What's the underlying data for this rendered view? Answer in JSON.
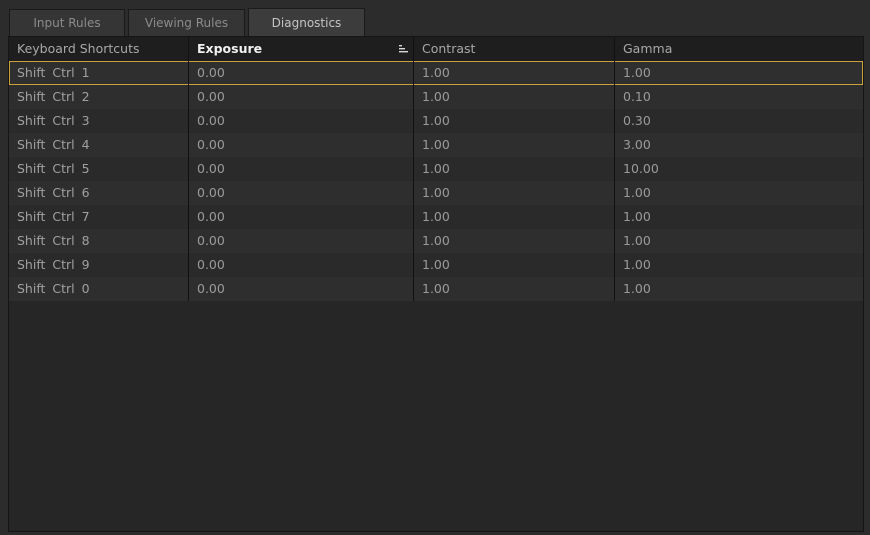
{
  "tabs": [
    {
      "label": "Input Rules",
      "active": false
    },
    {
      "label": "Viewing Rules",
      "active": false
    },
    {
      "label": "Diagnostics",
      "active": true
    }
  ],
  "table": {
    "columns": [
      {
        "label": "Keyboard Shortcuts",
        "sorted": false
      },
      {
        "label": "Exposure",
        "sorted": true,
        "sort_icon": "sort-descending-icon"
      },
      {
        "label": "Contrast",
        "sorted": false
      },
      {
        "label": "Gamma",
        "sorted": false
      }
    ],
    "selected_row": 0,
    "rows": [
      {
        "shortcut": "Shift Ctrl 1",
        "exposure": "0.00",
        "contrast": "1.00",
        "gamma": "1.00"
      },
      {
        "shortcut": "Shift Ctrl 2",
        "exposure": "0.00",
        "contrast": "1.00",
        "gamma": "0.10"
      },
      {
        "shortcut": "Shift Ctrl 3",
        "exposure": "0.00",
        "contrast": "1.00",
        "gamma": "0.30"
      },
      {
        "shortcut": "Shift Ctrl 4",
        "exposure": "0.00",
        "contrast": "1.00",
        "gamma": "3.00"
      },
      {
        "shortcut": "Shift Ctrl 5",
        "exposure": "0.00",
        "contrast": "1.00",
        "gamma": "10.00"
      },
      {
        "shortcut": "Shift Ctrl 6",
        "exposure": "0.00",
        "contrast": "1.00",
        "gamma": "1.00"
      },
      {
        "shortcut": "Shift Ctrl 7",
        "exposure": "0.00",
        "contrast": "1.00",
        "gamma": "1.00"
      },
      {
        "shortcut": "Shift Ctrl 8",
        "exposure": "0.00",
        "contrast": "1.00",
        "gamma": "1.00"
      },
      {
        "shortcut": "Shift Ctrl 9",
        "exposure": "0.00",
        "contrast": "1.00",
        "gamma": "1.00"
      },
      {
        "shortcut": "Shift Ctrl 0",
        "exposure": "0.00",
        "contrast": "1.00",
        "gamma": "1.00"
      }
    ]
  },
  "colors": {
    "selection_outline": "#c9a23a",
    "background": "#2c2c2c",
    "header_bg": "#1e1e1e"
  }
}
